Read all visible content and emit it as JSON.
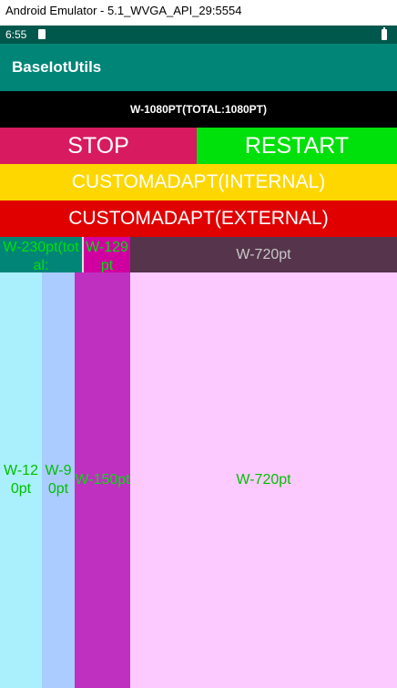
{
  "window": {
    "title": "Android Emulator - 5.1_WVGA_API_29:5554"
  },
  "status_bar": {
    "time": "6:55"
  },
  "toolbar": {
    "title": "BaseIotUtils"
  },
  "header": {
    "width_label": "W-1080PT(TOTAL:1080PT)"
  },
  "buttons": {
    "stop": "STOP",
    "restart": "RESTART",
    "custom_internal": "CUSTOMADAPT(INTERNAL)",
    "custom_external": "CUSTOMADAPT(EXTERNAL)"
  },
  "row1": {
    "cell_a": "W-230pt(total:",
    "cell_b": "W-129pt",
    "cell_c": "W-720pt"
  },
  "row2": {
    "cell_a": "W-120pt",
    "cell_b": "W-90pt",
    "cell_c": "W-150pt",
    "cell_d": "W-720pt"
  },
  "colors": {
    "status_bar": "#00574b",
    "toolbar": "#008577",
    "stop": "#d81b60",
    "restart": "#00e00a",
    "internal": "#ffd700",
    "external": "#e00000"
  }
}
